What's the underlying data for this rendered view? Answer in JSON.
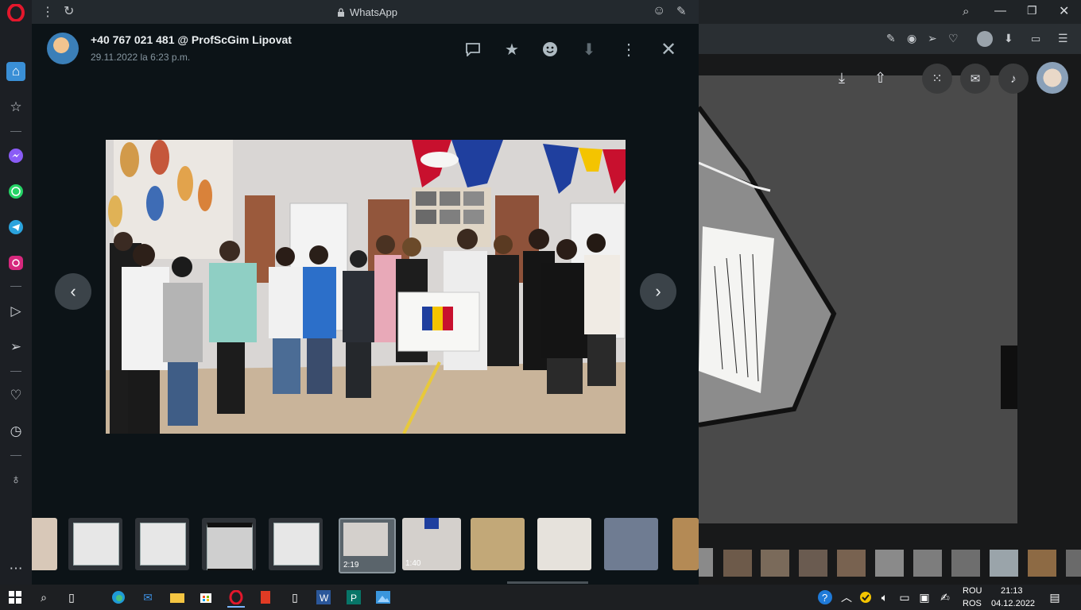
{
  "app": {
    "title": "WhatsApp"
  },
  "viewer": {
    "sender": "+40 767 021 481 @ ProfScGim Lipovat",
    "timestamp": "29.11.2022 la 6:23 p.m."
  },
  "thumbnails": [
    {
      "type": "image"
    },
    {
      "type": "image"
    },
    {
      "type": "image"
    },
    {
      "type": "image"
    },
    {
      "type": "image"
    },
    {
      "type": "video",
      "duration": "2:19",
      "selected": true
    },
    {
      "type": "video",
      "duration": "1:40"
    },
    {
      "type": "image"
    },
    {
      "type": "image"
    },
    {
      "type": "image"
    },
    {
      "type": "image"
    }
  ],
  "taskbar": {
    "language_top": "ROU",
    "language_bottom": "ROS",
    "time": "21:13",
    "date": "04.12.2022"
  },
  "colors": {
    "opera_red": "#e3172c",
    "whatsapp_dark": "#0c1317",
    "taskbar": "#1d1f22",
    "flag_blue": "#1f3f9e",
    "flag_yellow": "#f4c400",
    "flag_red": "#c8102e"
  }
}
